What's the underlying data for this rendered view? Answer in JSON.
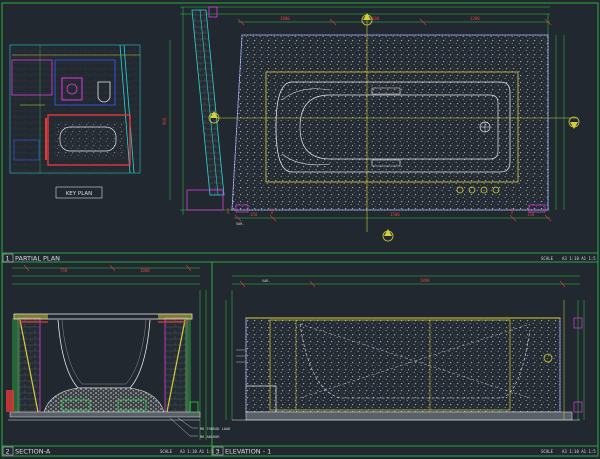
{
  "title_blocks": [
    {
      "number": "1",
      "title": "PARTIAL PLAN",
      "scale_label": "SCALE",
      "scale_value": "A3 1:10  A1 1:5"
    },
    {
      "number": "2",
      "title": "SECTION-A",
      "scale_label": "SCALE",
      "scale_value": "A3 1:10  A1 1:5"
    },
    {
      "number": "3",
      "title": "ELEVATION - 1",
      "scale_label": "SCALE",
      "scale_value": "A3 1:10  A1 1:5"
    }
  ],
  "key_plan": {
    "label": "KEY PLAN"
  },
  "section_notes": [
    "M8 THREAD LOAD",
    "M8 ANCHOR"
  ],
  "plan_dims": {
    "top": [
      "1800",
      "600",
      "1200"
    ],
    "bottom": [
      "150",
      "1500",
      "150"
    ],
    "left": "900",
    "var_label": "VAR."
  },
  "section_dims": {
    "top": [
      "750",
      "1000"
    ]
  },
  "elevation_dims": {
    "top": [
      "1800",
      "VAR."
    ]
  },
  "colors": {
    "background": "#212830",
    "frame": "#2ecc40",
    "wall": "#28d7d7",
    "dimension": "#e03a3a",
    "outline": "#d4cf3a",
    "pattern": "#8a8f96",
    "blue": "#3a5cff",
    "magenta": "#e03adf",
    "white": "#e8e8e8"
  }
}
